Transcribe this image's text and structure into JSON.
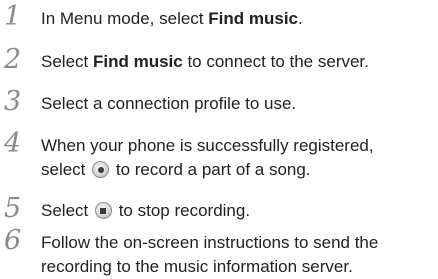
{
  "steps": [
    {
      "number": "1",
      "pre": "In Menu mode, select ",
      "bold": "Find music",
      "post": "."
    },
    {
      "number": "2",
      "pre": "Select ",
      "bold": "Find music",
      "post": " to connect to the server."
    },
    {
      "number": "3",
      "text": "Select a connection profile to use."
    },
    {
      "number": "4",
      "line1": "When your phone is successfully registered,",
      "line2_pre": "select ",
      "icon": "record-button-icon",
      "line2_post": " to record a part of a song."
    },
    {
      "number": "5",
      "pre": "Select ",
      "icon": "stop-button-icon",
      "post": " to stop recording."
    },
    {
      "number": "6",
      "line1": "Follow the on-screen instructions to send the",
      "line2": "recording to the music information server."
    }
  ]
}
